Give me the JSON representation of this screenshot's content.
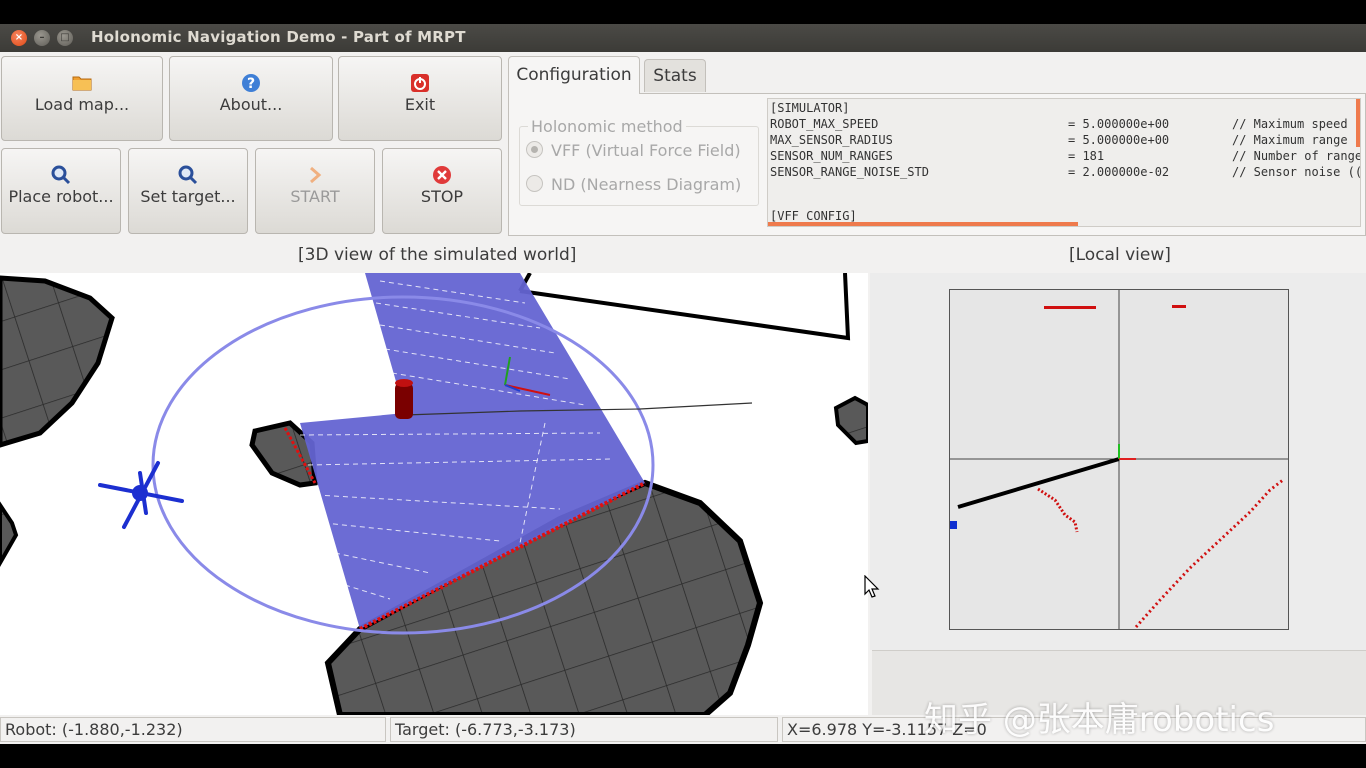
{
  "window": {
    "title": "Holonomic Navigation Demo - Part of MRPT"
  },
  "toolbar": {
    "buttons": [
      {
        "label": "Load map...",
        "icon": "folder-icon"
      },
      {
        "label": "About...",
        "icon": "help-icon"
      },
      {
        "label": "Exit",
        "icon": "power-icon"
      },
      {
        "label": "Place robot...",
        "icon": "magnifier-icon"
      },
      {
        "label": "Set target...",
        "icon": "magnifier-icon"
      },
      {
        "label": "START",
        "icon": "chevron-right-icon",
        "enabled": false
      },
      {
        "label": "STOP",
        "icon": "stop-icon"
      }
    ]
  },
  "tabs": [
    {
      "label": "Configuration",
      "active": true
    },
    {
      "label": "Stats",
      "active": false
    }
  ],
  "holonomic_method": {
    "title": "Holonomic method",
    "options": [
      {
        "label": "VFF (Virtual Force Field)",
        "selected": true
      },
      {
        "label": "ND (Nearness  Diagram)",
        "selected": false
      }
    ]
  },
  "config_text": {
    "section": "[SIMULATOR]",
    "rows": [
      {
        "key": "ROBOT_MAX_SPEED",
        "value": "= 5.000000e+00",
        "comment": "// Maximum speed"
      },
      {
        "key": "MAX_SENSOR_RADIUS",
        "value": "= 5.000000e+00",
        "comment": "// Maximum range"
      },
      {
        "key": "SENSOR_NUM_RANGES",
        "value": "= 181",
        "comment": "// Number of range"
      },
      {
        "key": "SENSOR_RANGE_NOISE_STD",
        "value": "= 2.000000e-02",
        "comment": "// Sensor noise (("
      }
    ],
    "next_section": "[VFF_CONFIG]"
  },
  "captions": {
    "view3d": "[3D view of the simulated world]",
    "local": "[Local view]"
  },
  "status": {
    "robot": "Robot: (-1.880,-1.232)",
    "target": "Target: (-6.773,-3.173)",
    "cursor": "X=6.978 Y=-3.1157 Z=0"
  },
  "watermark": "知乎 @张本庸robotics",
  "colors": {
    "accent": "#ef7a4c",
    "obstacle": "#5a5a5a",
    "sensor_fan": "#6464d2",
    "laser_points": "#e01010"
  }
}
